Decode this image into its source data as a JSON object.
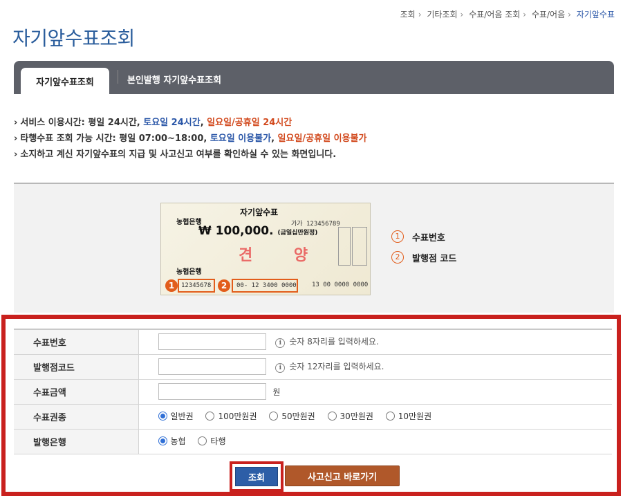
{
  "breadcrumb": [
    "조회",
    "기타조회",
    "수표/어음 조회",
    "수표/어음",
    "자기앞수표"
  ],
  "page_title": "자기앞수표조회",
  "tabs": [
    {
      "label": "자기앞수표조회",
      "active": true
    },
    {
      "label": "본인발행 자기앞수표조회",
      "active": false
    }
  ],
  "info": {
    "line1": {
      "prefix": "서비스 이용시간: 평일 24시간, ",
      "sat": "토요일 24시간",
      "comma": ", ",
      "sun": "일요일/공휴일 24시간"
    },
    "line2": {
      "prefix": "타행수표 조회 가능 시간: 평일 07:00~18:00, ",
      "sat": "토요일 이용불가",
      "comma": ", ",
      "sun": "일요일/공휴일 이용불가"
    },
    "line3": "소지하고 계신 자기앞수표의 지급 및 사고신고 여부를 확인하실 수 있는 화면입니다."
  },
  "check_image": {
    "bank": "농협은행",
    "title": "자기앞수표",
    "serial": "가가 123456789",
    "amount": "₩ 100,000.",
    "amount_words": "(금일십만원정)",
    "stamp": "견 양",
    "check_number": "12345678",
    "branch_code": "00- 12 3400 0000",
    "trailing_number": "13 00 0000 0000",
    "badge1": "1",
    "badge2": "2"
  },
  "legend": [
    {
      "num": "1",
      "label": "수표번호"
    },
    {
      "num": "2",
      "label": "발행점 코드"
    }
  ],
  "form": {
    "check_number": {
      "label": "수표번호",
      "value": "",
      "hint": "숫자 8자리를 입력하세요."
    },
    "branch_code": {
      "label": "발행점코드",
      "value": "",
      "hint": "숫자 12자리를 입력하세요."
    },
    "amount": {
      "label": "수표금액",
      "value": "",
      "unit": "원"
    },
    "check_type": {
      "label": "수표권종",
      "options": [
        "일반권",
        "100만원권",
        "50만원권",
        "30만원권",
        "10만원권"
      ],
      "selected": "일반권"
    },
    "issuing_bank": {
      "label": "발행은행",
      "options": [
        "농협",
        "타행"
      ],
      "selected": "농협"
    }
  },
  "buttons": {
    "search": "조회",
    "report": "사고신고 바로가기"
  },
  "colors": {
    "title": "#2a5d9c",
    "tabbar": "#5d6068",
    "highlight_border": "#c9211e",
    "search_button": "#2d5ea7",
    "report_button": "#b0582a",
    "blue_text": "#2b57a8",
    "red_text": "#d24a1e"
  }
}
